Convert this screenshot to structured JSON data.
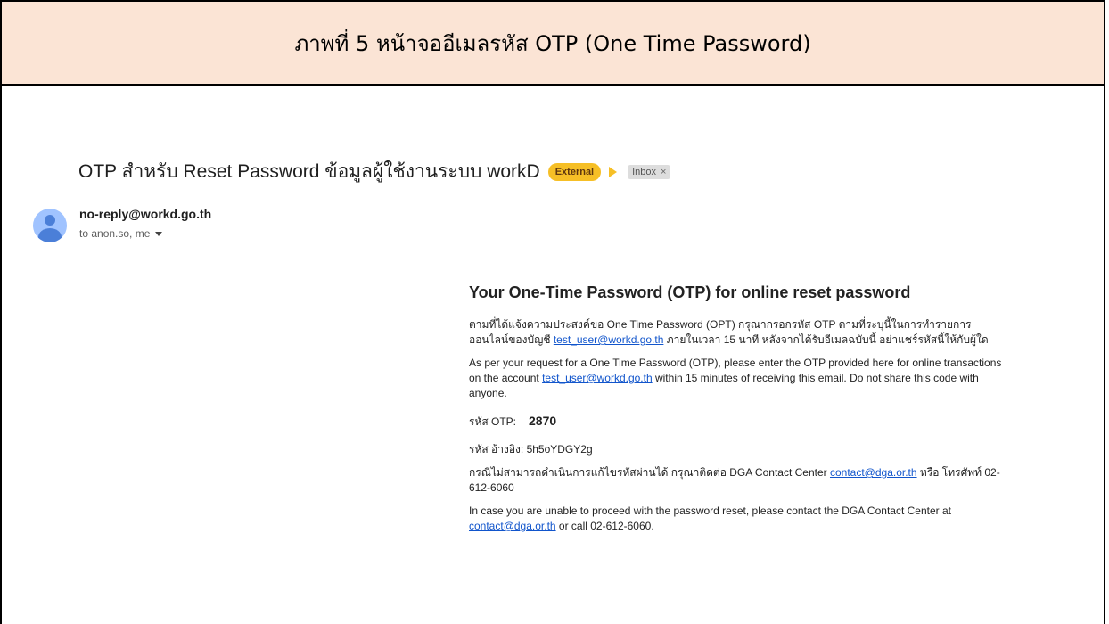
{
  "caption": "ภาพที่ 5 หน้าจออีเมลรหัส OTP (One Time Password)",
  "email": {
    "subject": "OTP สำหรับ Reset Password ข้อมูลผู้ใช้งานระบบ workD",
    "badge_external": "External",
    "label_inbox": "Inbox",
    "label_remove": "×",
    "sender": "no-reply@workd.go.th",
    "recipients": "to anon.so, me"
  },
  "body": {
    "heading": "Your One-Time Password (OTP) for online reset password",
    "th_para_1": "ตามที่ได้แจ้งความประสงค์ขอ One Time Password (OPT) กรุณากรอกรหัส OTP ตามที่ระบุนี้ในการทำรายการออนไลน์ของบัญชี ",
    "th_para_1_link": "test_user@workd.go.th",
    "th_para_1_tail": " ภายในเวลา 15 นาที หลังจากได้รับอีเมลฉบับนี้ อย่าแชร์รหัสนี้ให้กับผู้ใด",
    "en_para_1": "As per your request for a One Time Password (OTP), please enter the OTP provided here for online transactions on the account ",
    "en_para_1_link": "test_user@workd.go.th",
    "en_para_1_tail": " within 15 minutes of receiving this email. Do not share this code with anyone.",
    "otp_label": "รหัส OTP:",
    "otp_value": "2870",
    "ref_label": "รหัส อ้างอิง:",
    "ref_value": "5h5oYDGY2g",
    "th_para_2": "กรณีไม่สามารถดำเนินการแก้ไขรหัสผ่านได้ กรุณาติดต่อ DGA Contact Center ",
    "th_para_2_link": "contact@dga.or.th",
    "th_para_2_tail": " หรือ โทรศัพท์ 02-612-6060",
    "en_para_2": "In case you are unable to proceed with the password reset, please contact the DGA Contact Center at ",
    "en_para_2_link": "contact@dga.or.th",
    "en_para_2_tail": " or call 02-612-6060."
  },
  "colors": {
    "caption_bg": "#fbe4d5",
    "external_badge": "#f6bf26",
    "link": "#1155cc",
    "avatar": "#a0c3ff"
  },
  "icons": {
    "avatar": "person-avatar-icon",
    "importance": "importance-marker-icon",
    "recipients_caret": "chevron-down-icon"
  }
}
